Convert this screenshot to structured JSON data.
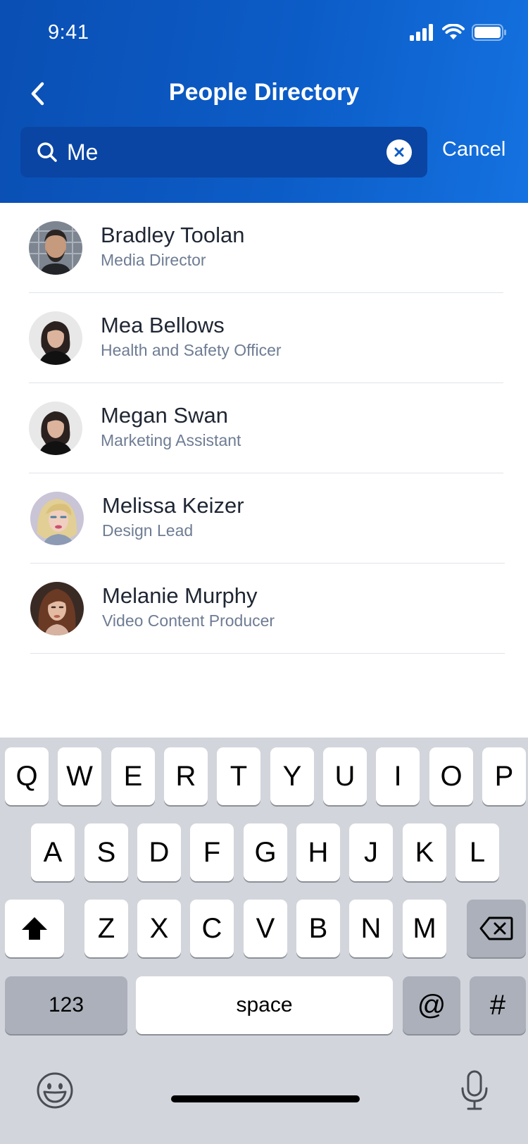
{
  "status_bar": {
    "time": "9:41"
  },
  "header": {
    "title": "People Directory",
    "search": {
      "value": "Me",
      "placeholder": "Search"
    },
    "cancel_label": "Cancel"
  },
  "results": [
    {
      "name": "Bradley Toolan",
      "role": "Media Director"
    },
    {
      "name": "Mea Bellows",
      "role": "Health and Safety Officer"
    },
    {
      "name": "Megan Swan",
      "role": "Marketing Assistant"
    },
    {
      "name": "Melissa Keizer",
      "role": "Design Lead"
    },
    {
      "name": "Melanie Murphy",
      "role": "Video Content Producer"
    }
  ],
  "keyboard": {
    "row1": [
      "Q",
      "W",
      "E",
      "R",
      "T",
      "Y",
      "U",
      "I",
      "O",
      "P"
    ],
    "row2": [
      "A",
      "S",
      "D",
      "F",
      "G",
      "H",
      "J",
      "K",
      "L"
    ],
    "row3": [
      "Z",
      "X",
      "C",
      "V",
      "B",
      "N",
      "M"
    ],
    "numbers_label": "123",
    "space_label": "space",
    "at_label": "@",
    "hash_label": "#"
  },
  "icons": {
    "back": "chevron-left-icon",
    "search": "search-icon",
    "clear": "clear-icon",
    "shift": "shift-icon",
    "delete": "backspace-icon",
    "emoji": "emoji-icon",
    "mic": "microphone-icon"
  },
  "colors": {
    "header": "#0c5cc7",
    "search_box": "#0a45a3",
    "keyboard_bg": "#d2d5db"
  }
}
